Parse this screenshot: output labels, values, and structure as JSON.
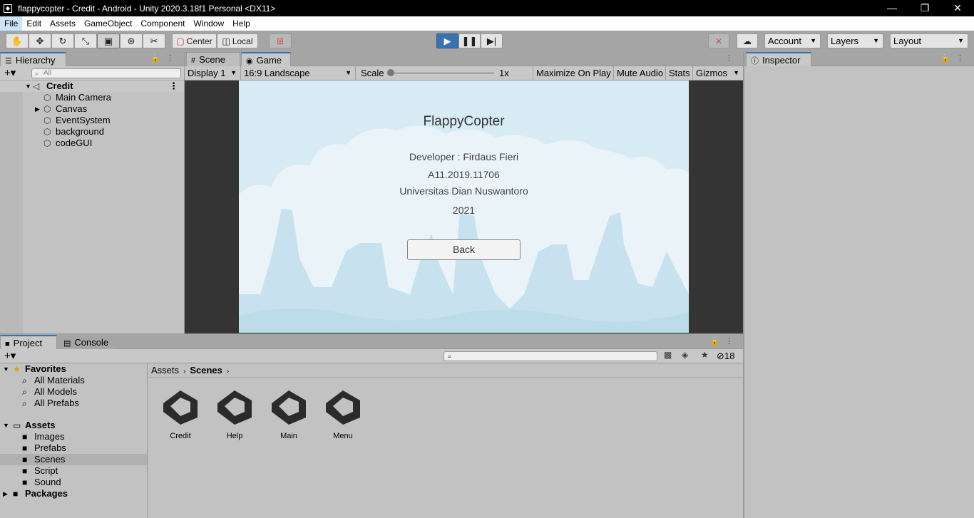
{
  "window": {
    "title": "flappycopter - Credit - Android - Unity 2020.3.18f1 Personal <DX11>",
    "controls": {
      "minimize": "—",
      "maximize": "❐",
      "close": "✕"
    }
  },
  "menu": [
    "File",
    "Edit",
    "Assets",
    "GameObject",
    "Component",
    "Window",
    "Help"
  ],
  "toolbar": {
    "pivot_mode": "Center",
    "pivot_rotation": "Local",
    "account": "Account",
    "layers": "Layers",
    "layout": "Layout"
  },
  "hierarchy": {
    "tab": "Hierarchy",
    "search_placeholder": "All",
    "scene": "Credit",
    "items": [
      "Main Camera",
      "Canvas",
      "EventSystem",
      "background",
      "codeGUI"
    ]
  },
  "scene_tab": "Scene",
  "game": {
    "tab": "Game",
    "display": "Display 1",
    "aspect": "16:9 Landscape",
    "scale_label": "Scale",
    "scale_value": "1x",
    "maximize_on_play": "Maximize On Play",
    "mute_audio": "Mute Audio",
    "stats": "Stats",
    "gizmos": "Gizmos",
    "content": {
      "title": "FlappyCopter",
      "developer": "Developer : Firdaus Fieri",
      "id": "A11.2019.11706",
      "university": "Universitas Dian  Nuswantoro",
      "year": "2021",
      "back_button": "Back"
    }
  },
  "inspector": {
    "tab": "Inspector"
  },
  "project": {
    "tab": "Project",
    "console_tab": "Console",
    "hidden_count": "18",
    "favorites": {
      "label": "Favorites",
      "items": [
        "All Materials",
        "All Models",
        "All Prefabs"
      ]
    },
    "assets": {
      "label": "Assets",
      "items": [
        "Images",
        "Prefabs",
        "Scenes",
        "Script",
        "Sound"
      ],
      "selected": "Scenes"
    },
    "packages": "Packages",
    "breadcrumb": [
      "Assets",
      "Scenes"
    ],
    "scene_files": [
      "Credit",
      "Help",
      "Main",
      "Menu"
    ]
  },
  "colors": {
    "play_active": "#3a72b0",
    "game_sky": "#d7ebf4",
    "editor_bg": "#c2c2c2"
  }
}
